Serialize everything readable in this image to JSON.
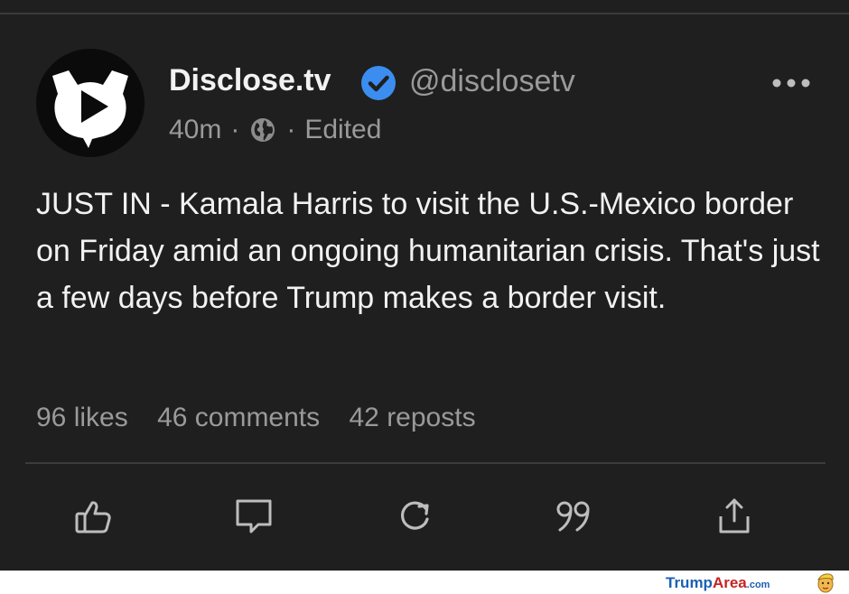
{
  "post": {
    "author_name": "Disclose.tv",
    "handle": "@disclosetv",
    "time": "40m",
    "separator": "·",
    "edited": "Edited",
    "text": "JUST IN - Kamala Harris to visit the U.S.-Mexico border on Friday amid an ongoing humanitarian crisis. That's just a few days before Trump makes a border visit.",
    "stats": {
      "likes": "96 likes",
      "comments": "46 comments",
      "reposts": "42 reposts"
    },
    "icons": {
      "avatar": "disclose-tv-logo",
      "verified": "verified-badge-icon",
      "more": "more-options-icon",
      "visibility": "globe-icon",
      "like": "thumbs-up-icon",
      "comment": "comment-icon",
      "repost": "repost-icon",
      "quote": "quote-icon",
      "share": "share-icon"
    }
  },
  "watermark": {
    "part1": "Trump",
    "part2": "Area",
    "part3": ".com"
  },
  "colors": {
    "background": "#1f1f1f",
    "text_primary": "#f2f2f2",
    "text_secondary": "#9a9a9a",
    "verified": "#3b8ef0"
  }
}
